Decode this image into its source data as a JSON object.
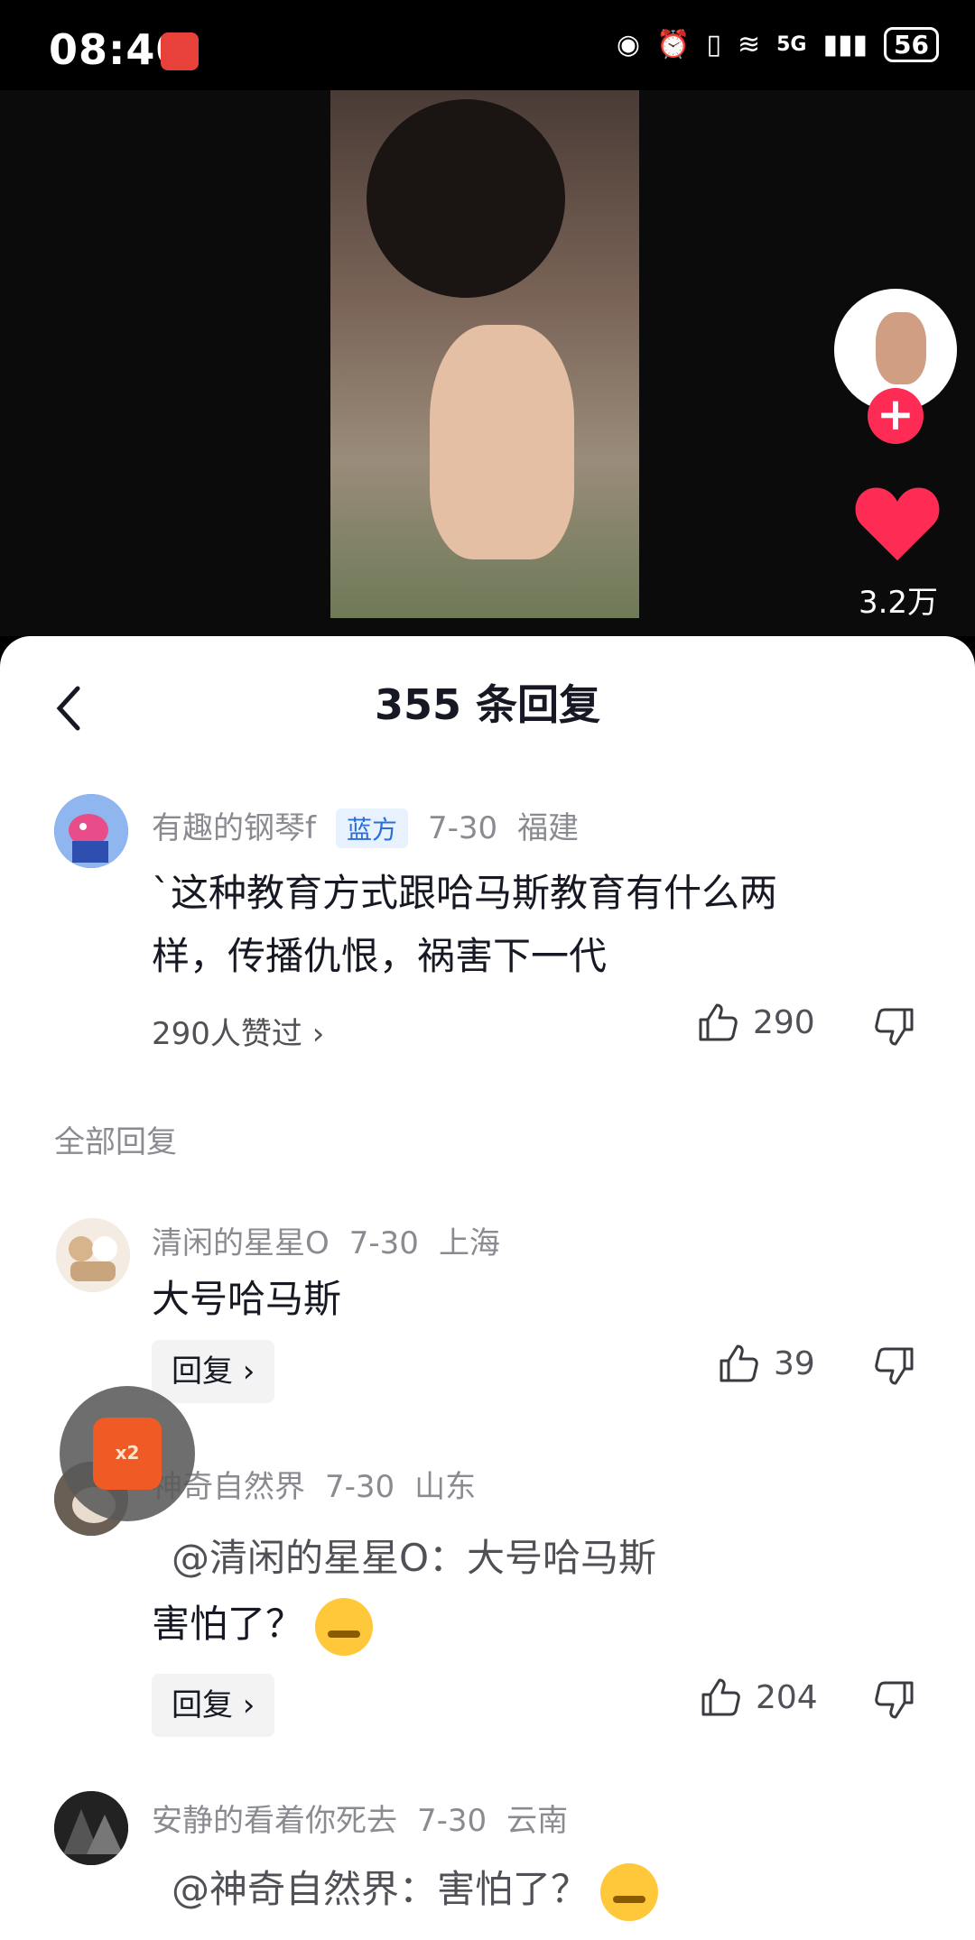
{
  "status_bar": {
    "time": "08:40",
    "network": "5G",
    "battery": "56"
  },
  "video": {
    "like_count": "3.2万"
  },
  "sheet": {
    "title": "355 条回复"
  },
  "main_comment": {
    "username": "有趣的钢琴f",
    "tag": "蓝方",
    "date": "7-30",
    "location": "福建",
    "text_line1": "`这种教育方式跟哈马斯教育有什么两",
    "text_line2": "样，传播仇恨，祸害下一代",
    "likes_summary": "290人赞过 ›",
    "like_count": "290"
  },
  "section_label": "全部回复",
  "replies": [
    {
      "username": "清闲的星星O",
      "date": "7-30",
      "location": "上海",
      "text": "大号哈马斯",
      "reply_label": "回复 ›",
      "like_count": "39"
    },
    {
      "username": "神奇自然界",
      "date": "7-30",
      "location": "山东",
      "quote": "@清闲的星星O：大号哈马斯",
      "text": "害怕了？",
      "reply_label": "回复 ›",
      "like_count": "204"
    },
    {
      "username": "安静的看着你死去",
      "date": "7-30",
      "location": "云南",
      "quote": "@神奇自然界：害怕了？"
    }
  ],
  "float_badge": {
    "label": "x2"
  },
  "colors": {
    "accent": "#fe2c55",
    "tag_blue": "#2a6ed8"
  }
}
